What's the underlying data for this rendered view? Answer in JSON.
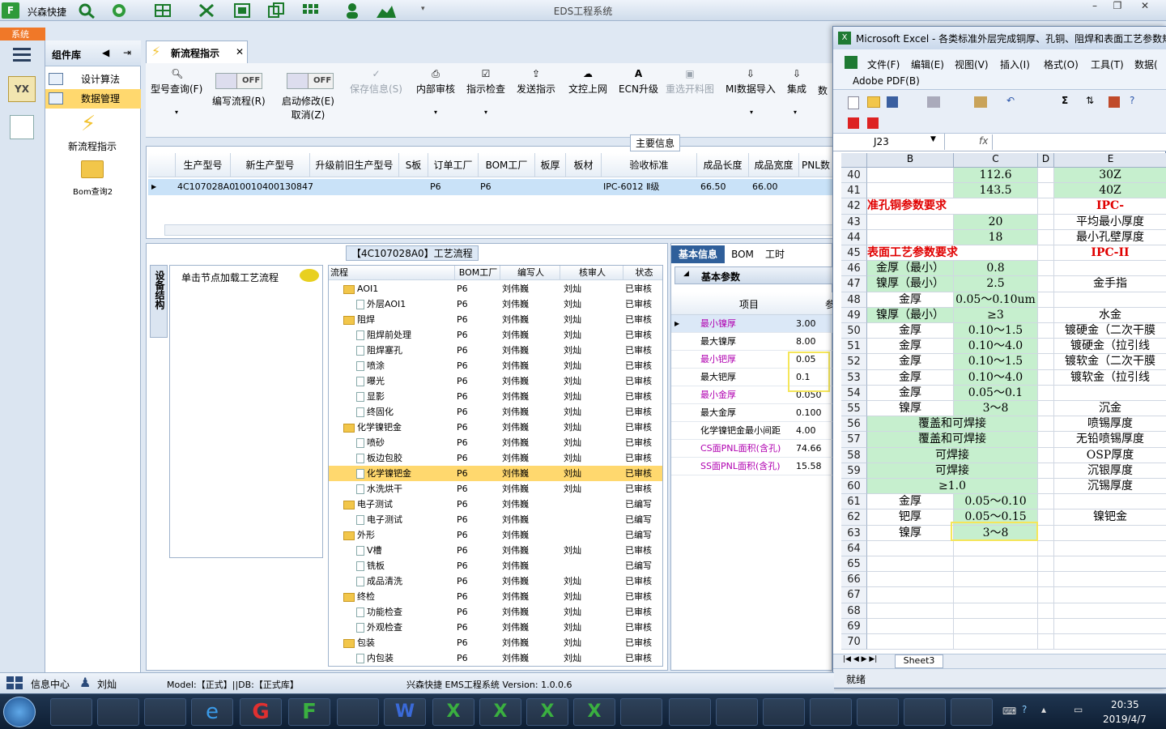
{
  "app": {
    "name": "兴森快捷",
    "window_title": "EDS工程系统"
  },
  "nav": {
    "top_label": "系统",
    "panel_title": "组件库",
    "items": [
      "设计算法",
      "数据管理"
    ],
    "actions": [
      "新流程指示",
      "Bom查询2"
    ]
  },
  "tab": {
    "label": "新流程指示"
  },
  "toolbar": {
    "buttons": [
      {
        "label": "型号查询(F)",
        "enabled": true
      },
      {
        "label": "编写流程(R)",
        "enabled": true
      },
      {
        "label": "启动修改(E)",
        "sub": "取消(Z)",
        "enabled": true
      },
      {
        "label": "保存信息(S)",
        "enabled": false
      },
      {
        "label": "内部审核",
        "enabled": true
      },
      {
        "label": "指示检查",
        "enabled": true
      },
      {
        "label": "发送指示",
        "enabled": true
      },
      {
        "label": "文控上网",
        "enabled": true
      },
      {
        "label": "ECN升级",
        "enabled": true
      },
      {
        "label": "重选开料图",
        "enabled": false
      },
      {
        "label": "MI数据导入",
        "enabled": true
      },
      {
        "label": "集成",
        "enabled": true
      },
      {
        "label": "数",
        "enabled": true
      }
    ],
    "toggle_label": "OFF"
  },
  "main_info": {
    "section_title": "主要信息",
    "headers": [
      "生产型号",
      "新生产型号",
      "升级前旧生产型号",
      "S板",
      "订单工厂",
      "BOM工厂",
      "板厚",
      "板材",
      "验收标准",
      "成品长度",
      "成品宽度",
      "PNL数"
    ],
    "row": [
      "4C107028A0",
      "10010400130847",
      "",
      "",
      "P6",
      "P6",
      "",
      "",
      "IPC-6012 Ⅱ级",
      "66.50",
      "66.00",
      ""
    ]
  },
  "process": {
    "title": "【4C107028A0】工艺流程",
    "side_tab": "设备结构",
    "node_hint": "单击节点加载工艺流程",
    "headers": [
      "流程",
      "BOM工厂",
      "编写人",
      "核审人",
      "状态"
    ],
    "rows": [
      {
        "name": "AOI1",
        "level": 0,
        "folder": true,
        "bom": "P6",
        "writer": "刘伟巍",
        "reviewer": "刘灿",
        "status": "已审核"
      },
      {
        "name": "外层AOI1",
        "level": 1,
        "folder": false,
        "bom": "P6",
        "writer": "刘伟巍",
        "reviewer": "刘灿",
        "status": "已审核"
      },
      {
        "name": "阻焊",
        "level": 0,
        "folder": true,
        "bom": "P6",
        "writer": "刘伟巍",
        "reviewer": "刘灿",
        "status": "已审核"
      },
      {
        "name": "阻焊前处理",
        "level": 1,
        "folder": false,
        "bom": "P6",
        "writer": "刘伟巍",
        "reviewer": "刘灿",
        "status": "已审核"
      },
      {
        "name": "阻焊塞孔",
        "level": 1,
        "folder": false,
        "bom": "P6",
        "writer": "刘伟巍",
        "reviewer": "刘灿",
        "status": "已审核"
      },
      {
        "name": "喷涂",
        "level": 1,
        "folder": false,
        "bom": "P6",
        "writer": "刘伟巍",
        "reviewer": "刘灿",
        "status": "已审核"
      },
      {
        "name": "曝光",
        "level": 1,
        "folder": false,
        "bom": "P6",
        "writer": "刘伟巍",
        "reviewer": "刘灿",
        "status": "已审核"
      },
      {
        "name": "显影",
        "level": 1,
        "folder": false,
        "bom": "P6",
        "writer": "刘伟巍",
        "reviewer": "刘灿",
        "status": "已审核"
      },
      {
        "name": "终固化",
        "level": 1,
        "folder": false,
        "bom": "P6",
        "writer": "刘伟巍",
        "reviewer": "刘灿",
        "status": "已审核"
      },
      {
        "name": "化学镍钯金",
        "level": 0,
        "folder": true,
        "bom": "P6",
        "writer": "刘伟巍",
        "reviewer": "刘灿",
        "status": "已审核"
      },
      {
        "name": "喷砂",
        "level": 1,
        "folder": false,
        "bom": "P6",
        "writer": "刘伟巍",
        "reviewer": "刘灿",
        "status": "已审核"
      },
      {
        "name": "板边包胶",
        "level": 1,
        "folder": false,
        "bom": "P6",
        "writer": "刘伟巍",
        "reviewer": "刘灿",
        "status": "已审核"
      },
      {
        "name": "化学镍钯金",
        "level": 1,
        "folder": false,
        "bom": "P6",
        "writer": "刘伟巍",
        "reviewer": "刘灿",
        "status": "已审核",
        "selected": true
      },
      {
        "name": "水洗烘干",
        "level": 1,
        "folder": false,
        "bom": "P6",
        "writer": "刘伟巍",
        "reviewer": "刘灿",
        "status": "已审核"
      },
      {
        "name": "电子测试",
        "level": 0,
        "folder": true,
        "bom": "P6",
        "writer": "刘伟巍",
        "reviewer": "",
        "status": "已编写"
      },
      {
        "name": "电子测试",
        "level": 1,
        "folder": false,
        "bom": "P6",
        "writer": "刘伟巍",
        "reviewer": "",
        "status": "已编写"
      },
      {
        "name": "外形",
        "level": 0,
        "folder": true,
        "bom": "P6",
        "writer": "刘伟巍",
        "reviewer": "",
        "status": "已编写"
      },
      {
        "name": "V槽",
        "level": 1,
        "folder": false,
        "bom": "P6",
        "writer": "刘伟巍",
        "reviewer": "刘灿",
        "status": "已审核"
      },
      {
        "name": "铣板",
        "level": 1,
        "folder": false,
        "bom": "P6",
        "writer": "刘伟巍",
        "reviewer": "",
        "status": "已编写"
      },
      {
        "name": "成品清洗",
        "level": 1,
        "folder": false,
        "bom": "P6",
        "writer": "刘伟巍",
        "reviewer": "刘灿",
        "status": "已审核"
      },
      {
        "name": "终检",
        "level": 0,
        "folder": true,
        "bom": "P6",
        "writer": "刘伟巍",
        "reviewer": "刘灿",
        "status": "已审核"
      },
      {
        "name": "功能检查",
        "level": 1,
        "folder": false,
        "bom": "P6",
        "writer": "刘伟巍",
        "reviewer": "刘灿",
        "status": "已审核"
      },
      {
        "name": "外观检查",
        "level": 1,
        "folder": false,
        "bom": "P6",
        "writer": "刘伟巍",
        "reviewer": "刘灿",
        "status": "已审核"
      },
      {
        "name": "包装",
        "level": 0,
        "folder": true,
        "bom": "P6",
        "writer": "刘伟巍",
        "reviewer": "刘灿",
        "status": "已审核"
      },
      {
        "name": "内包装",
        "level": 1,
        "folder": false,
        "bom": "P6",
        "writer": "刘伟巍",
        "reviewer": "刘灿",
        "status": "已审核"
      }
    ]
  },
  "params": {
    "tabs": [
      "基本信息",
      "BOM",
      "工时"
    ],
    "group": "基本参数",
    "col_header": "项目",
    "col_header2": "参",
    "rows": [
      {
        "name": "最小镍厚",
        "value": "3.00",
        "magenta": true
      },
      {
        "name": "最大镍厚",
        "value": "8.00",
        "magenta": false
      },
      {
        "name": "最小钯厚",
        "value": "0.05",
        "magenta": true
      },
      {
        "name": "最大钯厚",
        "value": "0.1",
        "magenta": false
      },
      {
        "name": "最小金厚",
        "value": "0.050",
        "magenta": true
      },
      {
        "name": "最大金厚",
        "value": "0.100",
        "magenta": false
      },
      {
        "name": "化学镍钯金最小间距",
        "value": "4.00",
        "magenta": false
      },
      {
        "name": "CS面PNL面积(含孔)",
        "value": "74.66",
        "magenta": true
      },
      {
        "name": "SS面PNL面积(含孔)",
        "value": "15.58",
        "magenta": true
      }
    ]
  },
  "excel": {
    "title": "Microsoft Excel - 各类标准外层完成铜厚、孔铜、阻焊和表面工艺参数规",
    "menu": [
      "文件(F)",
      "编辑(E)",
      "视图(V)",
      "插入(I)",
      "格式(O)",
      "工具(T)",
      "数据("
    ],
    "pdf_menu": "Adobe PDF(B)",
    "name_box": "J23",
    "fx": "fx",
    "col_headers": [
      "B",
      "C",
      "D",
      "E"
    ],
    "sheet_tab": "Sheet3",
    "status": "就绪",
    "rows": [
      {
        "n": "40",
        "c": "112.6",
        "e": "30Z"
      },
      {
        "n": "41",
        "c": "143.5",
        "e": "40Z"
      },
      {
        "n": "42",
        "b": "准孔铜参数要求",
        "e": "IPC-"
      },
      {
        "n": "43",
        "c": "20",
        "e": "平均最小厚度"
      },
      {
        "n": "44",
        "c": "18",
        "e": "最小孔壁厚度"
      },
      {
        "n": "45",
        "b": "表面工艺参数要求",
        "e": "IPC-II"
      },
      {
        "n": "46",
        "b": "金厚（最小）",
        "c": "0.8"
      },
      {
        "n": "47",
        "b": "镍厚（最小）",
        "c": "2.5",
        "e": "金手指"
      },
      {
        "n": "48",
        "b": "金厚",
        "c": "0.05～0.10um"
      },
      {
        "n": "49",
        "b": "镍厚（最小）",
        "c": "≥3",
        "e": "水金"
      },
      {
        "n": "50",
        "b": "金厚",
        "c": "0.10～1.5",
        "e": "镀硬金（二次干膜"
      },
      {
        "n": "51",
        "b": "金厚",
        "c": "0.10～4.0",
        "e": "镀硬金（拉引线"
      },
      {
        "n": "52",
        "b": "金厚",
        "c": "0.10～1.5",
        "e": "镀软金（二次干膜"
      },
      {
        "n": "53",
        "b": "金厚",
        "c": "0.10～4.0",
        "e": "镀软金（拉引线"
      },
      {
        "n": "54",
        "b": "金厚",
        "c": "0.05～0.1"
      },
      {
        "n": "55",
        "b": "镍厚",
        "c": "3～8",
        "e": "沉金"
      },
      {
        "n": "56",
        "bc": "覆盖和可焊接",
        "e": "喷锡厚度"
      },
      {
        "n": "57",
        "bc": "覆盖和可焊接",
        "e": "无铅喷锡厚度"
      },
      {
        "n": "58",
        "bc": "可焊接",
        "e": "OSP厚度"
      },
      {
        "n": "59",
        "bc": "可焊接",
        "e": "沉银厚度"
      },
      {
        "n": "60",
        "bc": "≥1.0",
        "e": "沉锡厚度"
      },
      {
        "n": "61",
        "b": "金厚",
        "c": "0.05～0.10"
      },
      {
        "n": "62",
        "b": "钯厚",
        "c": "0.05～0.15",
        "e": "镍钯金"
      },
      {
        "n": "63",
        "b": "镍厚",
        "c": "3～8"
      },
      {
        "n": "64"
      },
      {
        "n": "65"
      },
      {
        "n": "66"
      },
      {
        "n": "67"
      },
      {
        "n": "68"
      },
      {
        "n": "69"
      },
      {
        "n": "70"
      }
    ]
  },
  "statusbar": {
    "info": "信息中心",
    "user": "刘灿",
    "model": "Model:【正式】||DB:【正式库】",
    "version": "兴森快捷 EMS工程系统 Version: 1.0.0.6"
  },
  "clock": {
    "time": "20:35",
    "date": "2019/4/7"
  }
}
